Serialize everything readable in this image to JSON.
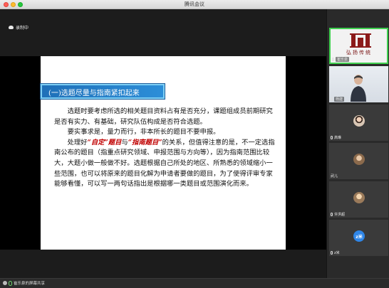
{
  "window": {
    "title": "腾讯会议"
  },
  "recording": {
    "label": "录制中"
  },
  "slide": {
    "banner": "(一)选题尽量与指南紧扣起来",
    "paragraphs": [
      {
        "text": "选题时要考虑所选的相关题目资料占有是否充分，课题组成员前期研究是否有实力、有基础，研究队伍构成是否符合选题。"
      },
      {
        "text": "要实事求是，量力而行，非本所长的题目不要申报。"
      },
      {
        "before": "处理好",
        "hl1": "“自定”题目",
        "mid": "与",
        "hl2": "“指南题目”",
        "after": "的关系，但值得注意的是，不一定选指南公布的题目（指重点研究领域、申报范围与方向等），因为指南范围比较大，大题小做一般做不好。选题根据自己所处的地区、所熟悉的领域缩小一些范围，也可以将原来的题目化解为申请者要做的题目，为了使得评审专家能够看懂，可以写一两句话指出是根据哪一类题目或范围演化而来。"
      }
    ]
  },
  "bottom_bar": {
    "sharer": "崔乐泉的屏幕共享"
  },
  "participants": [
    {
      "name": "崔乐泉",
      "type": "logo",
      "logo_text": "弘扬传统"
    },
    {
      "name": "杨建",
      "type": "camera"
    },
    {
      "name": "高琳",
      "type": "avatar"
    },
    {
      "name": "武儿",
      "type": "avatar"
    },
    {
      "name": "许洪超",
      "type": "avatar"
    },
    {
      "name": "z米",
      "type": "text-avatar",
      "initials": "z米"
    }
  ],
  "colors": {
    "active_speaker": "#3fcf4f",
    "banner": "#1f70b8",
    "highlight": "#c00000"
  }
}
